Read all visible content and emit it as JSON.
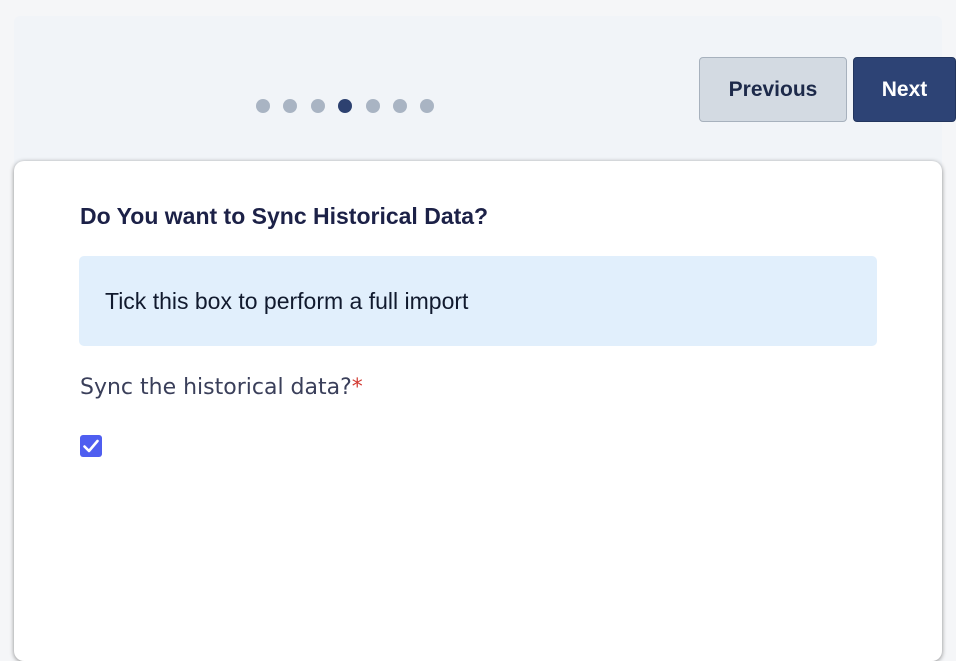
{
  "wizard": {
    "steps_total": 7,
    "current_step_index": 3,
    "prev_label": "Previous",
    "next_label": "Next"
  },
  "form": {
    "title": "Do You want to Sync Historical Data?",
    "info_text": "Tick this box to perform a full import",
    "field_label": "Sync the historical data?",
    "required_marker": "*",
    "checkbox_checked": true
  },
  "colors": {
    "primary": "#2d4375",
    "dot_inactive": "#a9b4c3",
    "info_bg": "#e1effc",
    "checkbox": "#4f5ef0",
    "required": "#d23b33"
  },
  "icons": {
    "checkbox": "checkmark-icon"
  }
}
